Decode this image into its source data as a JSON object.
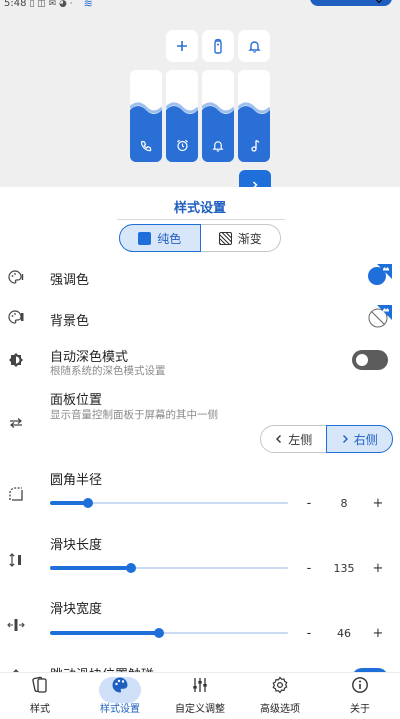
{
  "status_bar": {
    "time": "5:48"
  },
  "colors": {
    "accent": "#1e6fd9",
    "accent_light": "#d8e6fa",
    "preview_bg": "#efefef"
  },
  "preview": {
    "quick_buttons": [
      "plus-icon",
      "remote-icon",
      "bell-icon"
    ],
    "sliders": [
      {
        "icon": "phone-icon",
        "level": 0.7
      },
      {
        "icon": "alarm-icon",
        "level": 0.7
      },
      {
        "icon": "bell-icon",
        "level": 0.7
      },
      {
        "icon": "music-note-icon",
        "level": 0.7
      }
    ]
  },
  "sheet": {
    "title": "样式设置",
    "style_mode": {
      "options": [
        "纯色",
        "渐变"
      ],
      "selected": "纯色"
    },
    "accent_color": {
      "label": "强调色"
    },
    "background_color": {
      "label": "背景色"
    },
    "auto_dark": {
      "label": "自动深色模式",
      "description": "根随系统的深色模式设置",
      "enabled": false
    },
    "panel_position": {
      "label": "面板位置",
      "description": "显示音量控制面板于屏幕的其中一侧",
      "options": [
        "左侧",
        "右侧"
      ],
      "selected": "右侧"
    },
    "corner_radius": {
      "label": "圆角半径",
      "value": "8",
      "fraction": 0.16,
      "minus": "-",
      "plus": "+"
    },
    "slider_length": {
      "label": "滑块长度",
      "value": "135",
      "fraction": 0.34,
      "minus": "-",
      "plus": "+"
    },
    "slider_width": {
      "label": "滑块宽度",
      "value": "46",
      "fraction": 0.46,
      "minus": "-",
      "plus": "+"
    },
    "jump_slider": {
      "label": "跳动滑块位置触碰",
      "enabled": true
    }
  },
  "nav": {
    "items": [
      {
        "label": "样式",
        "icon": "style-icon"
      },
      {
        "label": "样式设置",
        "icon": "palette-icon",
        "active": true
      },
      {
        "label": "自定义调整",
        "icon": "tune-icon"
      },
      {
        "label": "高级选项",
        "icon": "settings-gear-icon"
      },
      {
        "label": "关于",
        "icon": "info-icon"
      }
    ]
  }
}
